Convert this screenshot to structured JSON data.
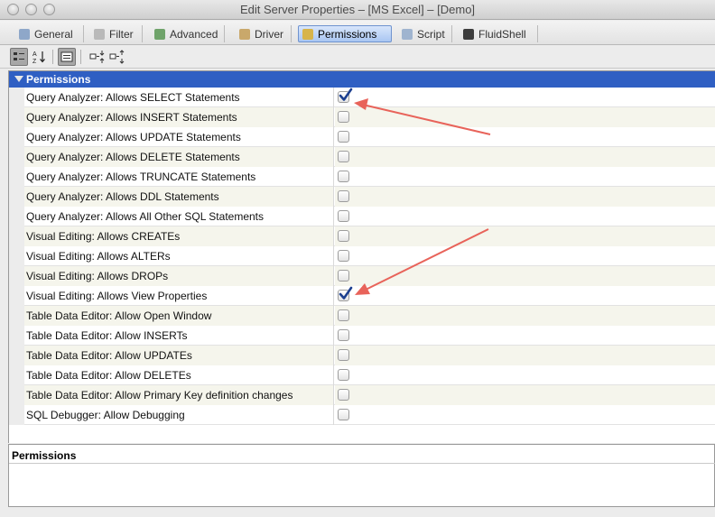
{
  "window": {
    "title": "Edit Server Properties – [MS Excel] – [Demo]"
  },
  "tabs": [
    {
      "label": "General",
      "icon": "general-icon",
      "active": false
    },
    {
      "label": "Filter",
      "icon": "filter-icon",
      "active": false
    },
    {
      "label": "Advanced",
      "icon": "advanced-icon",
      "active": false
    },
    {
      "label": "Driver",
      "icon": "driver-icon",
      "active": false
    },
    {
      "label": "Permissions",
      "icon": "permissions-icon",
      "active": true
    },
    {
      "label": "Script",
      "icon": "script-icon",
      "active": false
    },
    {
      "label": "FluidShell",
      "icon": "fluidshell-icon",
      "active": false
    }
  ],
  "toolbar": {
    "buttons": [
      "categorized-view-icon",
      "sort-alphabetical-icon",
      "show-description-icon",
      "expand-all-icon",
      "collapse-all-icon"
    ]
  },
  "group": {
    "label": "Permissions"
  },
  "properties": [
    {
      "name": "Query Analyzer: Allows SELECT Statements",
      "checked": true
    },
    {
      "name": "Query Analyzer: Allows INSERT Statements",
      "checked": false
    },
    {
      "name": "Query Analyzer: Allows UPDATE Statements",
      "checked": false
    },
    {
      "name": "Query Analyzer: Allows DELETE Statements",
      "checked": false
    },
    {
      "name": "Query Analyzer: Allows TRUNCATE Statements",
      "checked": false
    },
    {
      "name": "Query Analyzer: Allows DDL Statements",
      "checked": false
    },
    {
      "name": "Query Analyzer: Allows All Other SQL Statements",
      "checked": false
    },
    {
      "name": "Visual Editing: Allows CREATEs",
      "checked": false
    },
    {
      "name": "Visual Editing: Allows ALTERs",
      "checked": false
    },
    {
      "name": "Visual Editing: Allows DROPs",
      "checked": false
    },
    {
      "name": "Visual Editing: Allows View Properties",
      "checked": true
    },
    {
      "name": "Table Data Editor: Allow Open Window",
      "checked": false
    },
    {
      "name": "Table Data Editor: Allow INSERTs",
      "checked": false
    },
    {
      "name": "Table Data Editor: Allow UPDATEs",
      "checked": false
    },
    {
      "name": "Table Data Editor: Allow DELETEs",
      "checked": false
    },
    {
      "name": "Table Data Editor: Allow Primary Key definition changes",
      "checked": false
    },
    {
      "name": "SQL Debugger: Allow Debugging",
      "checked": false
    }
  ],
  "description": {
    "title": "Permissions"
  },
  "colors": {
    "group_header": "#2f5fc3",
    "annotation_arrow": "#e8635a",
    "checkmark": "#1c3f8f"
  }
}
